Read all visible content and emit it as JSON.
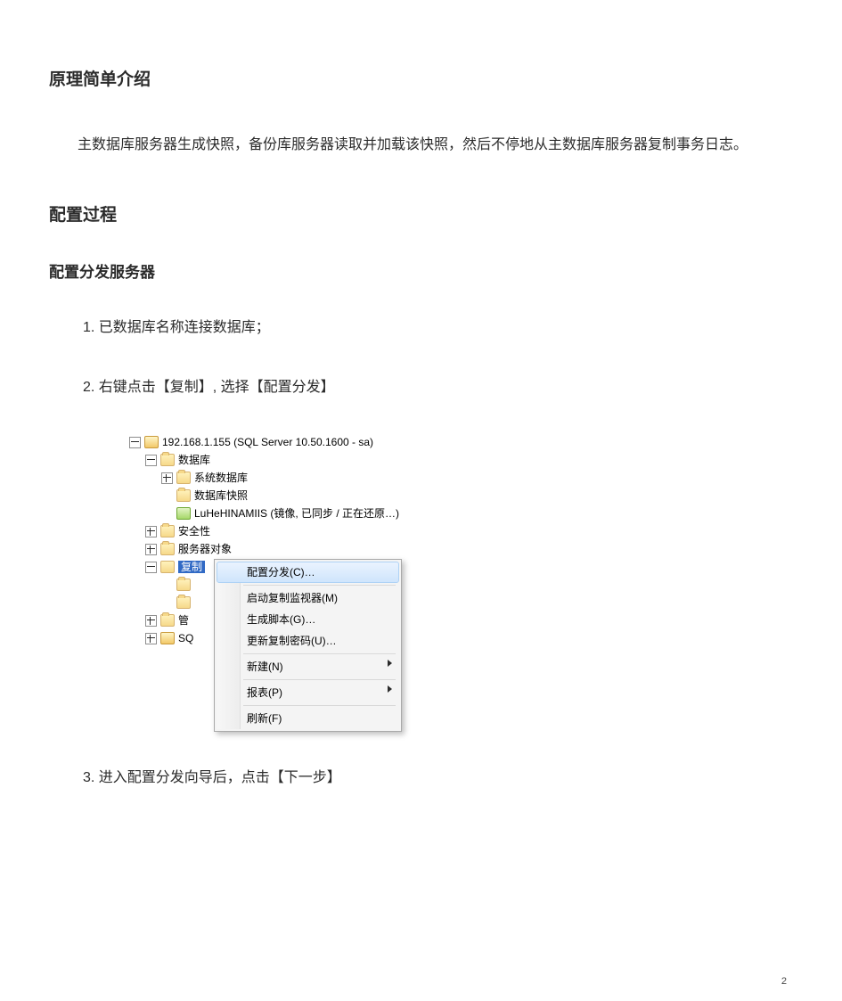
{
  "h1": "原理简单介绍",
  "intro": "主数据库服务器生成快照，备份库服务器读取并加载该快照，然后不停地从主数据库服务器复制事务日志。",
  "h2": "配置过程",
  "h3": "配置分发服务器",
  "steps": {
    "s1": "1. 已数据库名称连接数据库；",
    "s2": "2. 右键点击【复制】, 选择【配置分发】",
    "s3": "3. 进入配置分发向导后，点击【下一步】"
  },
  "tree": {
    "root": "192.168.1.155 (SQL Server 10.50.1600 - sa)",
    "databases": "数据库",
    "sysdb": "系统数据库",
    "snap": "数据库快照",
    "user_db": "LuHeHINAMIIS (镜像, 已同步 / 正在还原…)",
    "security": "安全性",
    "server_obj": "服务器对象",
    "replication": "复制",
    "mgmt_short": "管",
    "agent_short": "SQ"
  },
  "context_menu": {
    "configure": "配置分发(C)…",
    "launch_monitor": "启动复制监视器(M)",
    "gen_script": "生成脚本(G)…",
    "update_pwd": "更新复制密码(U)…",
    "new": "新建(N)",
    "reports": "报表(P)",
    "refresh": "刷新(F)"
  },
  "page_number": "2"
}
